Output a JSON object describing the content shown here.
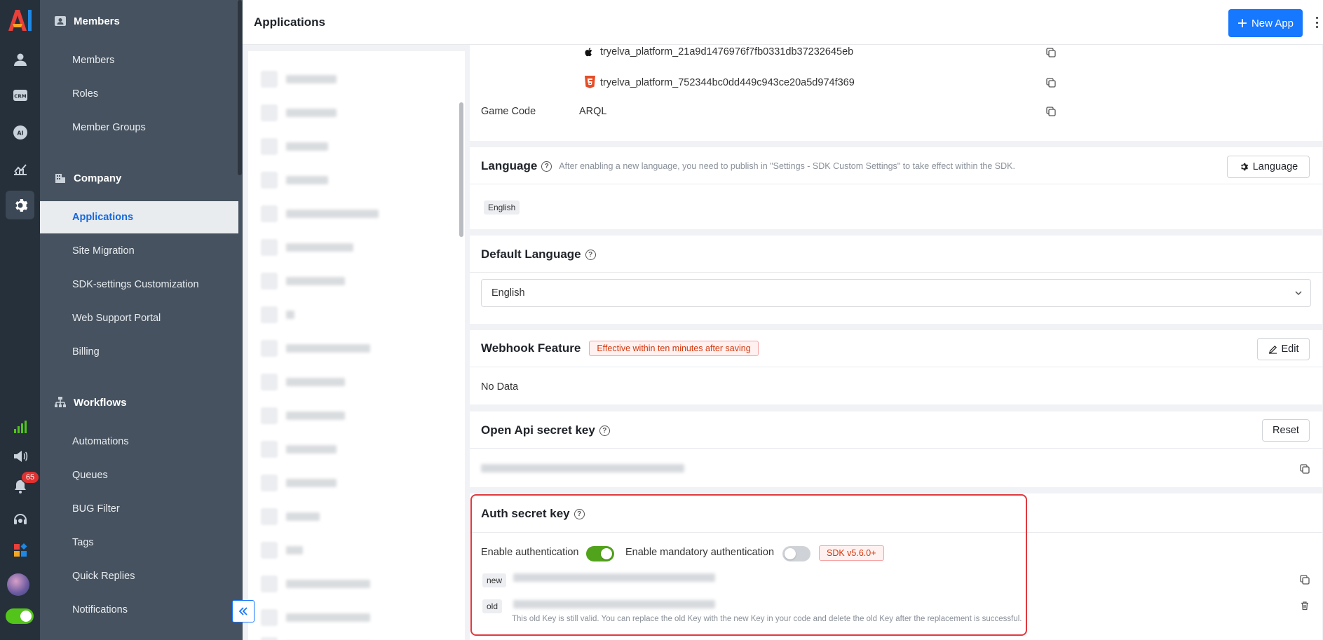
{
  "header": {
    "title": "Applications",
    "new_app_label": "New App"
  },
  "rail": {
    "notification_count": "65"
  },
  "sidebar": {
    "members_group": "Members",
    "members_items": [
      "Members",
      "Roles",
      "Member Groups"
    ],
    "company_group": "Company",
    "company_items": [
      "Applications",
      "Site Migration",
      "SDK-settings Customization",
      "Web Support Portal",
      "Billing"
    ],
    "workflows_group": "Workflows",
    "workflows_items": [
      "Automations",
      "Queues",
      "BUG Filter",
      "Tags",
      "Quick Replies",
      "Notifications"
    ]
  },
  "platform": {
    "ios_id": "tryelva_platform_21a9d1476976f7fb0331db37232645eb",
    "h5_id": "tryelva_platform_752344bc0dd449c943ce20a5d974f369",
    "game_code_label": "Game Code",
    "game_code_value": "ARQL"
  },
  "language": {
    "title": "Language",
    "hint": "After enabling a new language, you need to publish in \"Settings - SDK Custom Settings\" to take effect within the SDK.",
    "button": "Language",
    "tag": "English"
  },
  "default_language": {
    "title": "Default Language",
    "value": "English"
  },
  "webhook": {
    "title": "Webhook Feature",
    "tag": "Effective within ten minutes after saving",
    "button": "Edit",
    "empty": "No Data"
  },
  "open_api": {
    "title": "Open Api secret key",
    "button": "Reset"
  },
  "auth": {
    "title": "Auth secret key",
    "enable_label": "Enable authentication",
    "enable_on": true,
    "mandatory_label": "Enable mandatory authentication",
    "mandatory_on": false,
    "sdk_tag": "SDK v5.6.0+",
    "new_tag": "new",
    "old_tag": "old",
    "note": "This old Key is still valid. You can replace the old Key with the new Key in your code and delete the old Key after the replacement is successful."
  },
  "colors": {
    "primary": "#1677ff",
    "rail": "#26303b",
    "sidebar": "#46525f",
    "toggle_on": "#52a31c",
    "highlight": "#e0393e"
  }
}
